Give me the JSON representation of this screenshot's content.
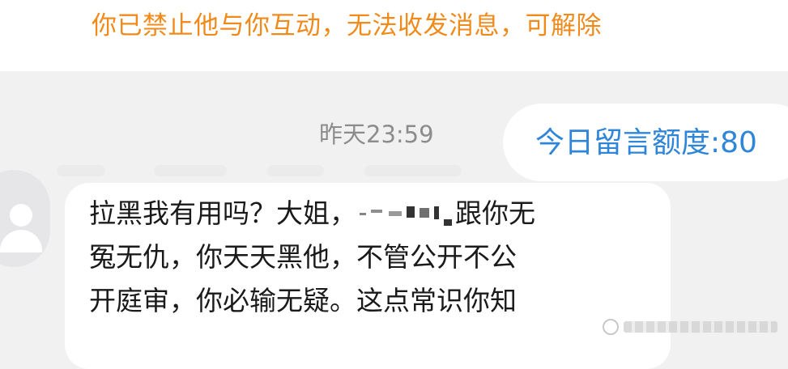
{
  "notice": {
    "text": "你已禁止他与你互动，无法收发消息，可解除"
  },
  "conversation": {
    "timestamp": "昨天23:59",
    "quota_text": "今日留言额度:80",
    "message": {
      "line1_before": "拉黑我有用吗？大姐，",
      "line1_after": "跟你无",
      "line2": "冤无仇，你天天黑他，不管公开不公",
      "line3": "开庭审，你必输无疑。这点常识你知"
    }
  },
  "colors": {
    "notice_text": "#f08a1a",
    "quota_text": "#2f86d8",
    "timestamp_text": "#8c8c8c",
    "chat_background": "#f1f1f2",
    "bubble_background": "#ffffff"
  },
  "icons": {
    "avatar": "user-avatar-placeholder-icon",
    "watermark": "weibo-watermark-icon"
  }
}
